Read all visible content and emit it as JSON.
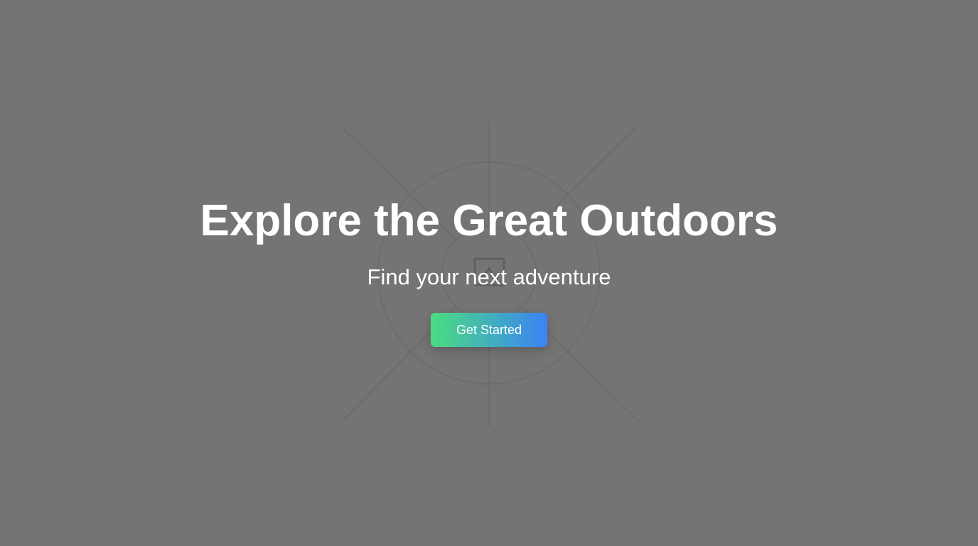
{
  "hero": {
    "headline": "Explore the Great Outdoors",
    "subheadline": "Find your next adventure",
    "cta_label": "Get Started"
  },
  "background_icon": "broken-image-icon",
  "colors": {
    "background": "#747474",
    "text": "#ffffff",
    "cta_gradient_start": "#4ade80",
    "cta_gradient_end": "#3b82f6",
    "placeholder_lines": "#6a6a6a"
  }
}
